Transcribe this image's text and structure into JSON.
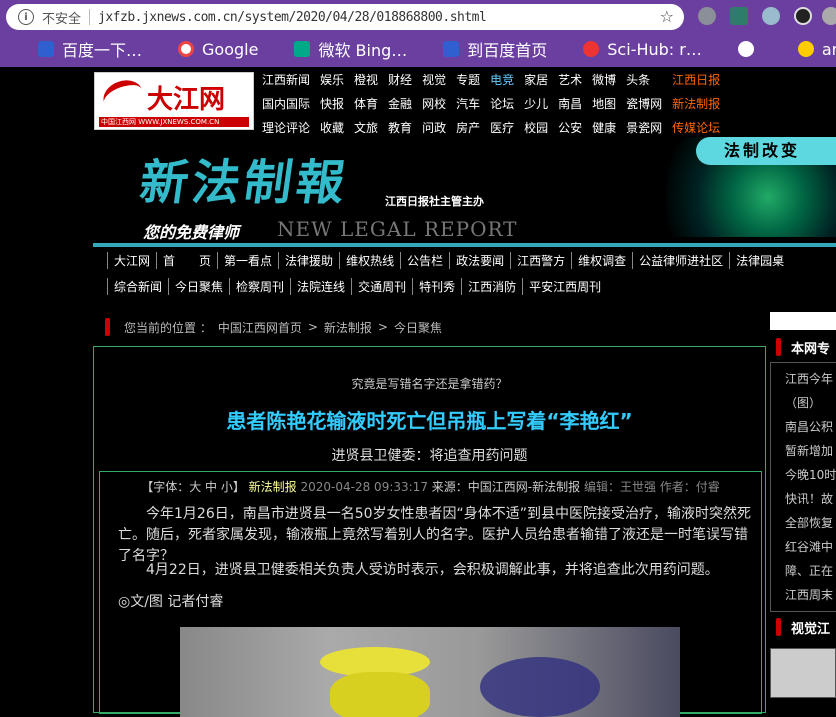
{
  "browser": {
    "security_label": "不安全",
    "url": "jxfzb.jxnews.com.cn/system/2020/04/28/018868800.shtml",
    "bookmarks": [
      {
        "label": "百度一下…",
        "icon": "baidu-paw-icon"
      },
      {
        "label": "Google",
        "icon": "google-icon"
      },
      {
        "label": "微软 Bing…",
        "icon": "bing-icon"
      },
      {
        "label": "到百度首页",
        "icon": "baidu-paw-icon"
      },
      {
        "label": "Sci-Hub: r…",
        "icon": "scihub-icon"
      },
      {
        "label": "",
        "icon": "globe-icon"
      },
      {
        "label": "arX",
        "icon": "smiley-icon"
      }
    ]
  },
  "site": {
    "logo_text": "大江网",
    "logo_sub": "中国江西网 WWW.JXNEWS.COM.CN",
    "nav": [
      [
        "江西新闻",
        "娱乐",
        "橙视",
        "财经",
        "视觉",
        "专题",
        "电竞",
        "家居",
        "艺术",
        "微博",
        "头条",
        "江西日报"
      ],
      [
        "国内国际",
        "快报",
        "体育",
        "金融",
        "网校",
        "汽车",
        "论坛",
        "少儿",
        "南昌",
        "地图",
        "瓷博网",
        "新法制报"
      ],
      [
        "理论评论",
        "收藏",
        "文旅",
        "教育",
        "问政",
        "房产",
        "医疗",
        "校园",
        "公安",
        "健康",
        "景瓷网",
        "传媒论坛"
      ]
    ]
  },
  "banner": {
    "logo_word": "新法制報",
    "sub": "江西日报社主管主办",
    "free": "您的免费律师",
    "english": "NEW LEGAL REPORT",
    "slogan": "法制改变"
  },
  "menu": {
    "row1": [
      "大江网",
      "首　　页",
      "第一看点",
      "法律援助",
      "维权热线",
      "公告栏",
      "政法要闻",
      "江西警方",
      "维权调查",
      "公益律师进社区",
      "法律园桌"
    ],
    "row2": [
      "综合新闻",
      "今日聚焦",
      "检察周刊",
      "法院连线",
      "交通周刊",
      "特刊秀",
      "江西消防",
      "平安江西周刊"
    ]
  },
  "breadcrumb": {
    "prefix": "您当前的位置 ：",
    "items": [
      "中国江西网首页",
      "新法制报",
      "今日聚焦"
    ],
    "sep": ">"
  },
  "article": {
    "kicker": "究竟是写错名字还是拿错药？",
    "title": "患者陈艳花输液时死亡但吊瓶上写着“李艳红”",
    "subtitle": "进贤县卫健委：将追查用药问题",
    "meta": {
      "font": "【字体：大 中 小】",
      "source_name": "新法制报",
      "datetime": "2020-04-28 09:33:17",
      "origin": "来源：中国江西网-新法制报",
      "editor": "编辑：王世强",
      "author": "作者：付睿"
    },
    "p1": "今年1月26日，南昌市进贤县一名50岁女性患者因“身体不适”到县中医院接受治疗，输液时突然死亡。随后，死者家属发现，输液瓶上竟然写着别人的名字。医护人员给患者输错了液还是一时笔误写错了名字？",
    "p2": "4月22日，进贤县卫健委相关负责人受访时表示，会积极调解此事，并将追查此次用药问题。",
    "p3": "◎文/图 记者付睿"
  },
  "sidebar": {
    "section1": "本网专",
    "items": [
      "江西今年",
      "（图）",
      "南昌公积",
      "暂新增加",
      "今晚10时",
      "快讯！故",
      "全部恢复",
      "红谷滩中",
      "障、正在",
      "江西周末"
    ],
    "section2": "视觉江"
  }
}
